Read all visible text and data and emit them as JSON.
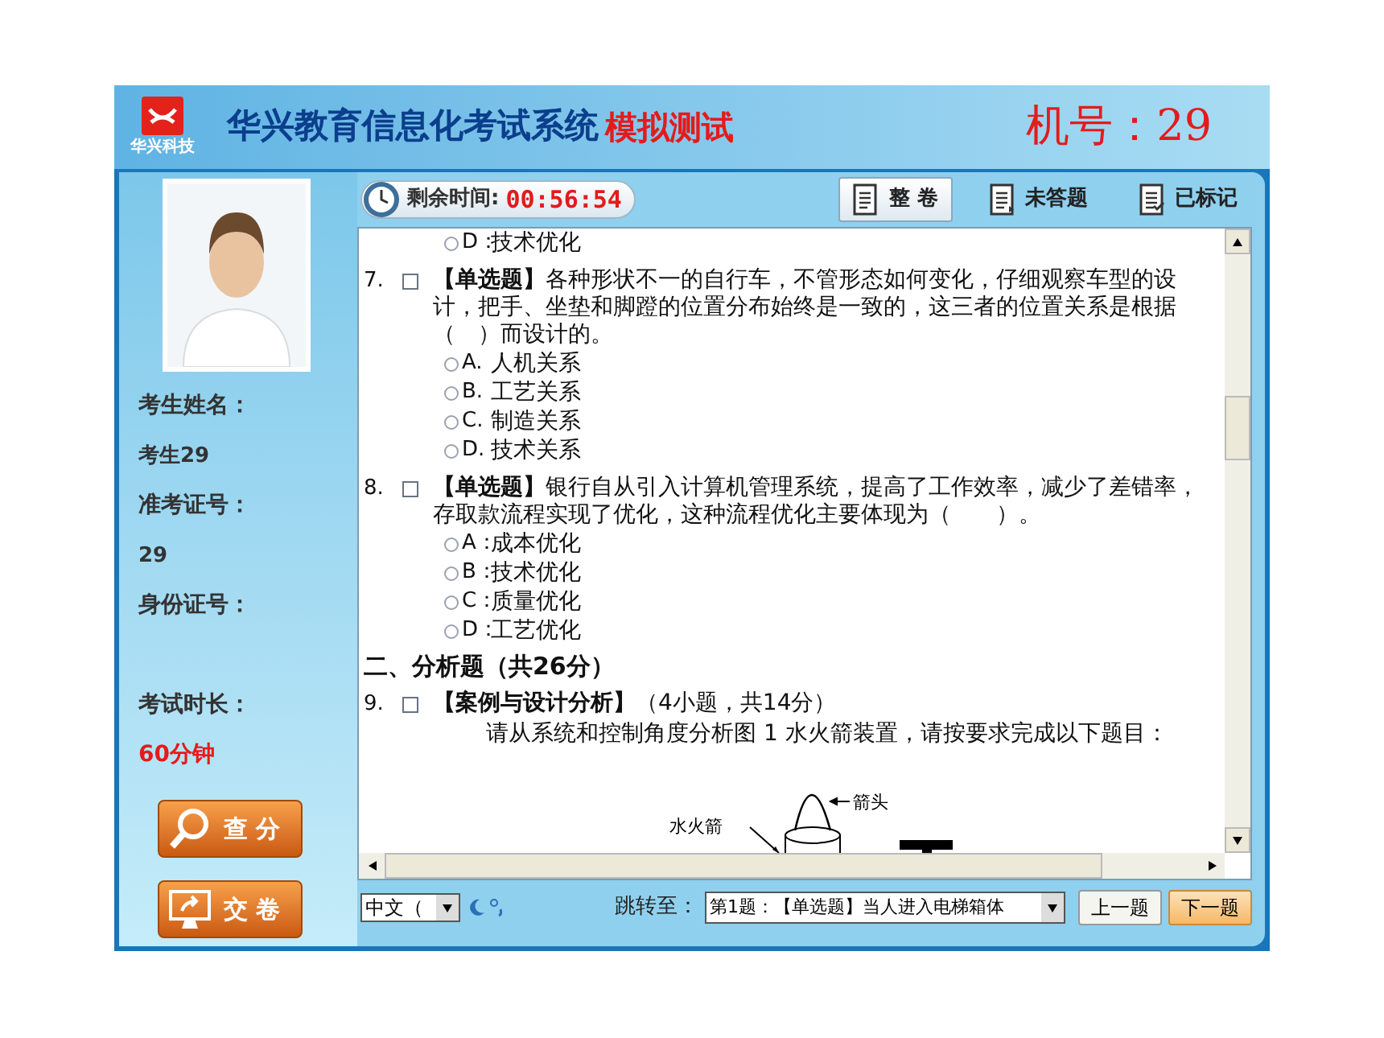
{
  "header": {
    "company": "华兴科技",
    "title": "华兴教育信息化考试系统",
    "mode": "模拟测试",
    "machine": "机号：29"
  },
  "timer": {
    "label": "剩余时间:",
    "value": "00:56:54"
  },
  "tabs": [
    {
      "label": "整 卷",
      "selected": true
    },
    {
      "label": "未答题",
      "selected": false
    },
    {
      "label": "已标记",
      "selected": false
    }
  ],
  "candidate": [
    {
      "kind": "label",
      "text": "考生姓名："
    },
    {
      "kind": "value",
      "text": "考生29"
    },
    {
      "kind": "label",
      "text": "准考证号："
    },
    {
      "kind": "value",
      "text": "29"
    },
    {
      "kind": "label",
      "text": "身份证号："
    },
    {
      "kind": "blank"
    },
    {
      "kind": "label",
      "text": "考试时长："
    },
    {
      "kind": "alert",
      "text": "60分钟"
    }
  ],
  "actions": [
    {
      "kind": "score",
      "label": "查 分"
    },
    {
      "kind": "submit",
      "label": "交 卷"
    }
  ],
  "items": [
    {
      "kind": "option",
      "label": "D：",
      "text": "技术优化",
      "selected": false
    },
    {
      "kind": "question",
      "number": "7.",
      "checked": false,
      "type": "【单选题】",
      "text": "各种形状不一的自行车，不管形态如何变化，仔细观察车型的设计，把手、坐垫和脚蹬的位置分布始终是一致的，这三者的位置关系是根据（　）而设计的。"
    },
    {
      "kind": "option",
      "label": "A.",
      "text": "人机关系",
      "selected": false
    },
    {
      "kind": "option",
      "label": "B.",
      "text": "工艺关系",
      "selected": false
    },
    {
      "kind": "option",
      "label": "C.",
      "text": "制造关系",
      "selected": false
    },
    {
      "kind": "option",
      "label": "D.",
      "text": "技术关系",
      "selected": false
    },
    {
      "kind": "question",
      "number": "8.",
      "checked": false,
      "type": "【单选题】",
      "text": "银行自从引入计算机管理系统，提高了工作效率，减少了差错率，存取款流程实现了优化，这种流程优化主要体现为（　　）。"
    },
    {
      "kind": "option",
      "label": "A：",
      "text": "成本优化",
      "selected": false
    },
    {
      "kind": "option",
      "label": "B：",
      "text": "技术优化",
      "selected": false
    },
    {
      "kind": "option",
      "label": "C：",
      "text": "质量优化",
      "selected": false
    },
    {
      "kind": "option",
      "label": "D：",
      "text": "工艺优化",
      "selected": false
    },
    {
      "kind": "section",
      "text": "二、分析题（共26分）"
    },
    {
      "kind": "question",
      "number": "9.",
      "checked": false,
      "type": "【案例与设计分析】",
      "text": "（4小题，共14分）"
    },
    {
      "kind": "instruction",
      "text": "请从系统和控制角度分析图 1 水火箭装置，请按要求完成以下题目："
    },
    {
      "kind": "figure",
      "labels": [
        "水火箭",
        "箭头"
      ]
    }
  ],
  "bottom": {
    "ime": "中文（",
    "jump_label": "跳转至：",
    "jump_value": "第1题：【单选题】当人进入电梯箱体",
    "prev": "上一题",
    "next": "下一题"
  }
}
